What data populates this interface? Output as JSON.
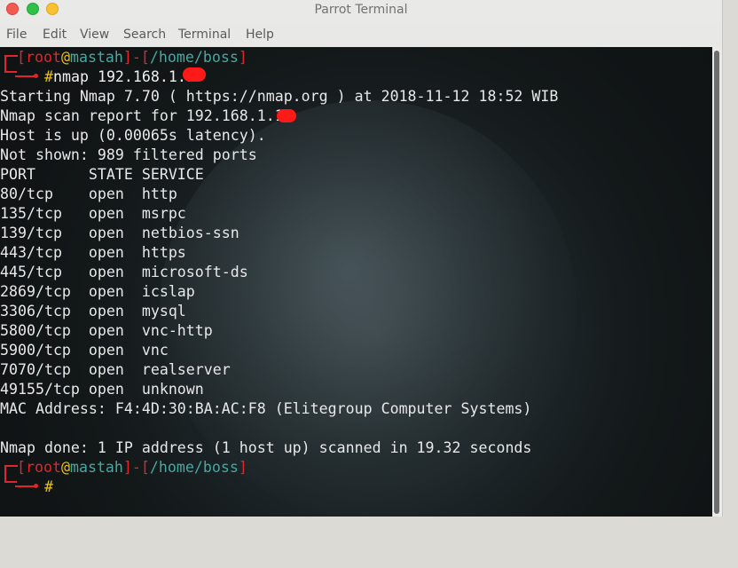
{
  "window": {
    "title": "Parrot Terminal"
  },
  "menu": [
    "File",
    "Edit",
    "View",
    "Search",
    "Terminal",
    "Help"
  ],
  "prompt": {
    "open": "[",
    "user": "root",
    "at": "@",
    "host": "mastah",
    "close": "]",
    "dash": "-",
    "path_open": "[",
    "path": "/home/boss",
    "path_close": "]",
    "hash": "#"
  },
  "command": "nmap 192.168.1.1",
  "output": [
    "Starting Nmap 7.70 ( https://nmap.org ) at 2018-11-12 18:52 WIB",
    "Nmap scan report for 192.168.1.1",
    "Host is up (0.00065s latency).",
    "Not shown: 989 filtered ports",
    "PORT      STATE SERVICE",
    "80/tcp    open  http",
    "135/tcp   open  msrpc",
    "139/tcp   open  netbios-ssn",
    "443/tcp   open  https",
    "445/tcp   open  microsoft-ds",
    "2869/tcp  open  icslap",
    "3306/tcp  open  mysql",
    "5800/tcp  open  vnc-http",
    "5900/tcp  open  vnc",
    "7070/tcp  open  realserver",
    "49155/tcp open  unknown",
    "MAC Address: F4:4D:30:BA:AC:F8 (Elitegroup Computer Systems)",
    "",
    "Nmap done: 1 IP address (1 host up) scanned in 19.32 seconds"
  ],
  "colors": {
    "prompt_bracket": "#e0262b",
    "prompt_host": "#46a8a0",
    "hash": "#f0c000",
    "redaction": "#ff1a1a"
  }
}
